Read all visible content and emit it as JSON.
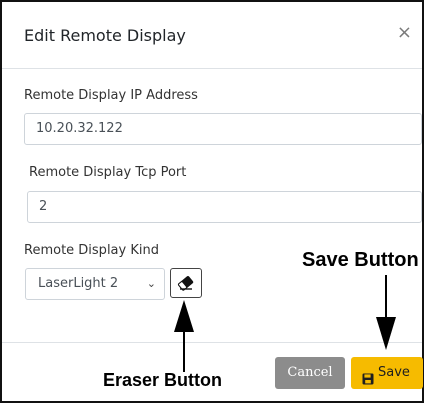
{
  "dialog": {
    "title": "Edit Remote Display",
    "close_symbol": "×"
  },
  "fields": {
    "ip": {
      "label": "Remote Display IP Address",
      "value": "10.20.32.122"
    },
    "port": {
      "label": "Remote Display Tcp Port",
      "value": "2"
    },
    "kind": {
      "label": "Remote Display Kind",
      "selected": "LaserLight 2"
    }
  },
  "footer": {
    "cancel_label": "Cancel",
    "save_label": "Save"
  },
  "annotations": {
    "save": "Save Button",
    "eraser": "Eraser Button"
  },
  "icons": {
    "close": "close-icon",
    "eraser": "eraser-icon",
    "save": "floppy-disk-icon",
    "dropdown": "chevron-down-icon"
  }
}
